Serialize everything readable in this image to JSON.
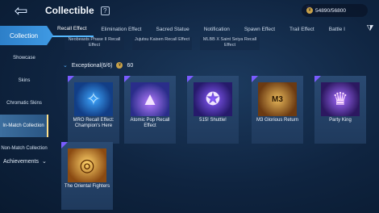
{
  "header": {
    "title": "Collectible",
    "currency_value": "54890/56800"
  },
  "tabs": [
    {
      "label": "Recall Effect",
      "active": true
    },
    {
      "label": "Elimination Effect",
      "active": false
    },
    {
      "label": "Sacred Statue",
      "active": false
    },
    {
      "label": "Notification",
      "active": false
    },
    {
      "label": "Spawn Effect",
      "active": false
    },
    {
      "label": "Trail Effect",
      "active": false
    },
    {
      "label": "Battle I",
      "active": false
    }
  ],
  "sidebar": {
    "main_label": "Collection",
    "items": [
      {
        "label": "Showcase",
        "active": false
      },
      {
        "label": "Skins",
        "active": false
      },
      {
        "label": "Chromatic Skins",
        "active": false
      },
      {
        "label": "In-Match Collection",
        "active": true
      },
      {
        "label": "Non-Match Collection",
        "active": false
      }
    ],
    "achievements_label": "Achievements"
  },
  "previous_row": [
    {
      "label": "Neobeasts Phase II Recall Effect"
    },
    {
      "label": "Jujutsu Kaisen Recall Effect"
    },
    {
      "label": "MLBB X Saint Seiya Recall Effect"
    }
  ],
  "section": {
    "title": "Exceptional(6/6)",
    "points": "60"
  },
  "items": [
    {
      "name": "MRO Recall Effect: Champion's Here",
      "icon": "mro-recall-art"
    },
    {
      "name": "Atomic Pop Recall Effect",
      "icon": "atomic-pop-art"
    },
    {
      "name": "515! Shuttle!",
      "icon": "shuttle-art"
    },
    {
      "name": "M3 Glorious Return",
      "icon": "m3-art",
      "badge": "M3"
    },
    {
      "name": "Party King",
      "icon": "party-king-art"
    },
    {
      "name": "The Oriental Fighters",
      "icon": "oriental-fighters-art"
    }
  ],
  "colors": {
    "accent": "#3f9ae4",
    "rarity": "#7a5cff",
    "highlight": "#ffe08a"
  }
}
